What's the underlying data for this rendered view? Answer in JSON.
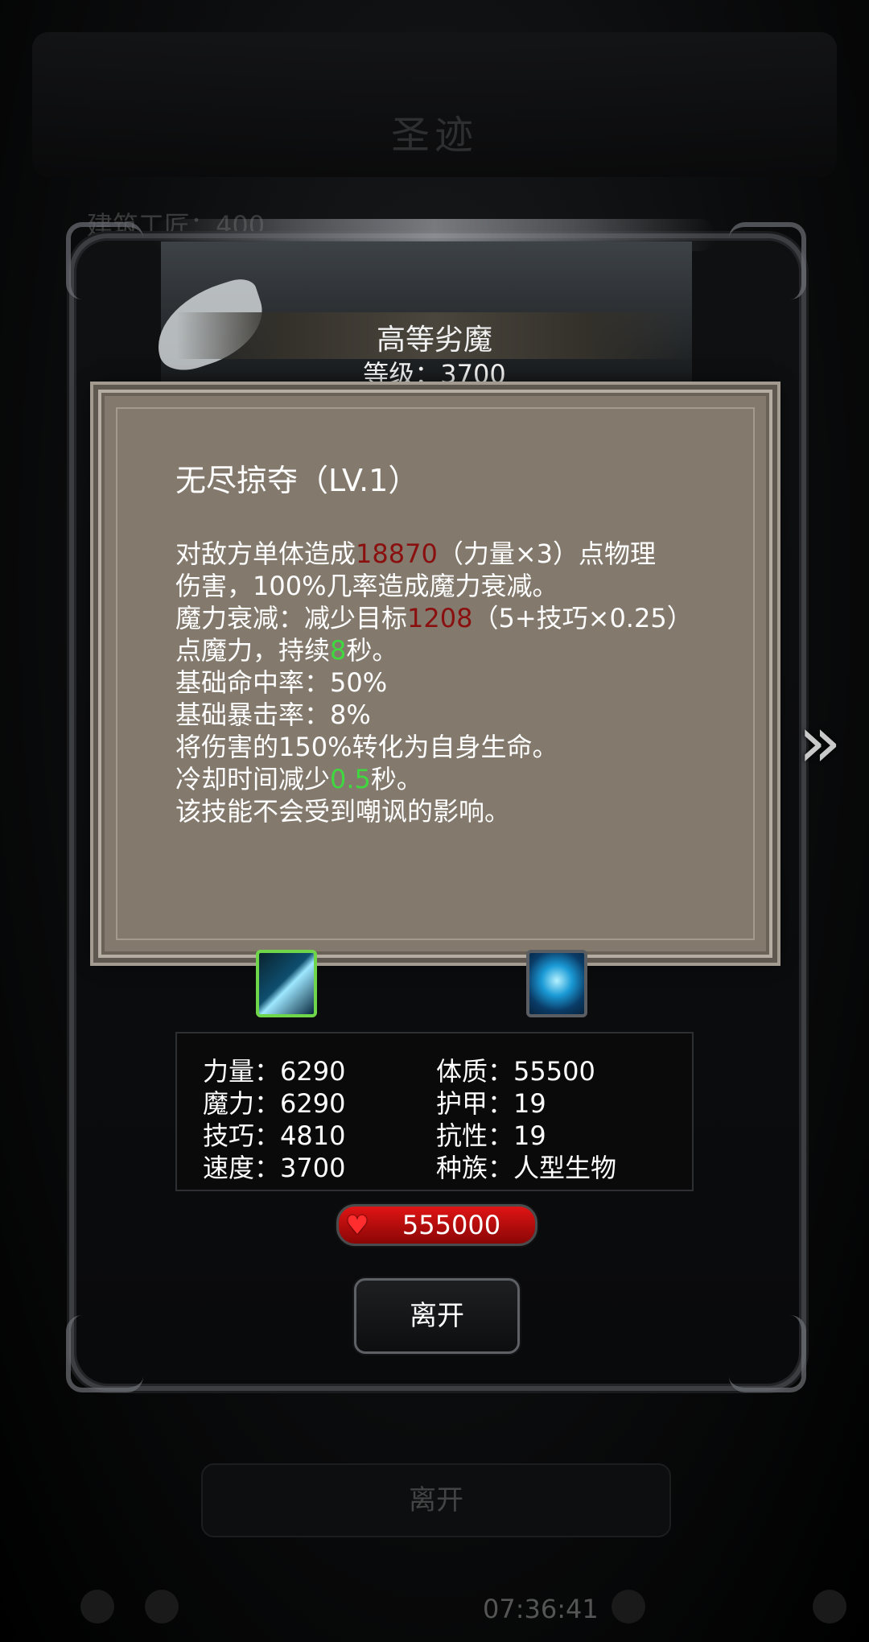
{
  "background": {
    "title": "圣迹",
    "label": "建筑工匠：400",
    "leave_label": "离开",
    "clock": "07:36:41"
  },
  "enemy": {
    "name": "高等劣魔",
    "level": "等级：3700"
  },
  "skill": {
    "title": "无尽掠夺（LV.1）",
    "lines": [
      [
        {
          "t": "对敌方单体造成"
        },
        {
          "t": "18870",
          "c": "red"
        },
        {
          "t": "（力量×3）点物理"
        }
      ],
      [
        {
          "t": "伤害，100%几率造成魔力衰减。"
        }
      ],
      [
        {
          "t": "魔力衰减：减少目标"
        },
        {
          "t": "1208",
          "c": "red"
        },
        {
          "t": "（5+技巧×0.25）"
        }
      ],
      [
        {
          "t": "点魔力，持续"
        },
        {
          "t": "8",
          "c": "green"
        },
        {
          "t": "秒。"
        }
      ],
      [
        {
          "t": "基础命中率：50%"
        }
      ],
      [
        {
          "t": "基础暴击率：8%"
        }
      ],
      [
        {
          "t": "将伤害的150%转化为自身生命。"
        }
      ],
      [
        {
          "t": "冷却时间减少"
        },
        {
          "t": "0.5",
          "c": "green"
        },
        {
          "t": "秒。"
        }
      ],
      [
        {
          "t": "该技能不会受到嘲讽的影响。"
        }
      ]
    ]
  },
  "stats": {
    "strength": "力量：6290",
    "magic": "魔力：6290",
    "skill": "技巧：4810",
    "speed": "速度：3700",
    "constitution": "体质：55500",
    "armor": "护甲：19",
    "resistance": "抗性：19",
    "race": "种族：人型生物"
  },
  "hp": {
    "icon": "heart-icon",
    "value": "555000"
  },
  "buttons": {
    "leave": "离开",
    "next": "»"
  },
  "colors": {
    "popup_bg": "#837a6d",
    "damage_red": "#8a1010",
    "duration_green": "#3fd83f",
    "hp_red": "#e01414"
  }
}
